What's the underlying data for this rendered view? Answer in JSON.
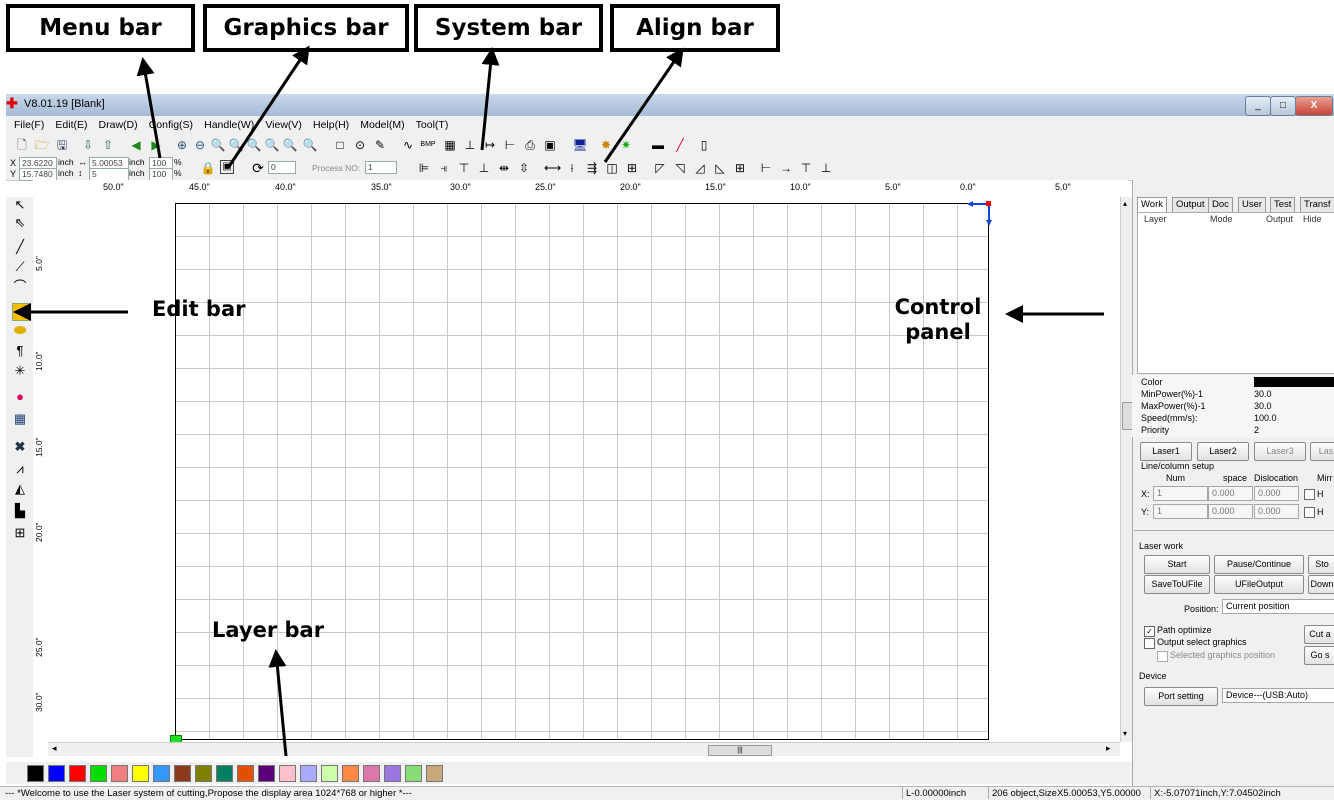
{
  "callouts": {
    "menu_bar": "Menu bar",
    "graphics_bar": "Graphics bar",
    "system_bar": "System bar",
    "align_bar": "Align bar",
    "edit_bar": "Edit bar",
    "control_panel_line1": "Control",
    "control_panel_line2": "panel",
    "layer_bar": "Layer bar"
  },
  "window": {
    "title": "V8.01.19 [Blank]",
    "minimize": "_",
    "maximize": "□",
    "close": "X"
  },
  "menu": [
    "File(F)",
    "Edit(E)",
    "Draw(D)",
    "Config(S)",
    "Handle(W)",
    "View(V)",
    "Help(H)",
    "Model(M)",
    "Tool(T)"
  ],
  "position_fields": {
    "x_label": "X",
    "y_label": "Y",
    "x_value": "23.6220",
    "y_value": "15.7480",
    "unit1": "inch",
    "unit2": "inch",
    "w_value": "5.00053",
    "h_value": "5",
    "unit3": "inch",
    "unit4": "inch",
    "pct1": "100",
    "pct2": "100",
    "pct_sym1": "%",
    "pct_sym2": "%",
    "rotate_value": "0",
    "process_label": "Process NO:",
    "process_value": "1"
  },
  "ruler_labels": [
    "50.0\"",
    "45.0\"",
    "40.0\"",
    "35.0\"",
    "30.0\"",
    "25.0\"",
    "20.0\"",
    "15.0\"",
    "10.0\"",
    "5.0\"",
    "0.0\"",
    "5.0\""
  ],
  "vruler_labels": [
    "5.0\"",
    "10.0\"",
    "15.0\"",
    "20.0\"",
    "25.0\"",
    "30.0\""
  ],
  "panel": {
    "tabs": [
      "Work",
      "Output",
      "Doc",
      "User",
      "Test",
      "Transf"
    ],
    "table_headers": [
      "Layer",
      "Mode",
      "Output",
      "Hide"
    ],
    "props": [
      {
        "label": "Color",
        "value": ""
      },
      {
        "label": "MinPower(%)-1",
        "value": "30.0"
      },
      {
        "label": "MaxPower(%)-1",
        "value": "30.0"
      },
      {
        "label": "Speed(mm/s):",
        "value": "100.0"
      },
      {
        "label": "Priority",
        "value": "2"
      }
    ],
    "laser_tabs": [
      "Laser1",
      "Laser2",
      "Laser3",
      "Las"
    ],
    "array_title": "Line/column setup",
    "array_headers": [
      "Num",
      "space",
      "Dislocation",
      "Mirr"
    ],
    "x_row": {
      "label": "X:",
      "num": "1",
      "space": "0.000",
      "disloc": "0.000",
      "mirror": "H"
    },
    "y_row": {
      "label": "Y:",
      "num": "1",
      "space": "0.000",
      "disloc": "0.000",
      "mirror": "H"
    },
    "laser_work_title": "Laser work",
    "start": "Start",
    "pause": "Pause/Continue",
    "stop": "Sto",
    "save_ufile": "SaveToUFile",
    "ufile_output": "UFileOutput",
    "download": "Down",
    "position_label": "Position:",
    "position_value": "Current position",
    "path_optimize": "Path optimize",
    "output_select": "Output select graphics",
    "selected_pos": "Selected graphics position",
    "cut_btn": "Cut a",
    "go_btn": "Go s",
    "device_title": "Device",
    "port_setting": "Port setting",
    "device_value": "Device---(USB:Auto)"
  },
  "status": {
    "message": "--- *Welcome to use the Laser system of cutting,Propose the display area 1024*768 or higher *---",
    "length": "L-0.00000inch",
    "objects": "206 object,SizeX5.00053,Y5.00000",
    "coords": "X:-5.07071inch,Y:7.04502inch"
  },
  "palette_colors": [
    "#000000",
    "#0000ff",
    "#ff0000",
    "#00dd00",
    "#f08080",
    "#ffff00",
    "#3399ff",
    "#8b3a1a",
    "#808000",
    "#008060",
    "#e05000",
    "#5a007a",
    "#ffc0cb",
    "#aaaaff",
    "#ccffaa",
    "#ff8844",
    "#dd77aa",
    "#9977dd",
    "#88dd77",
    "#c8a878"
  ]
}
